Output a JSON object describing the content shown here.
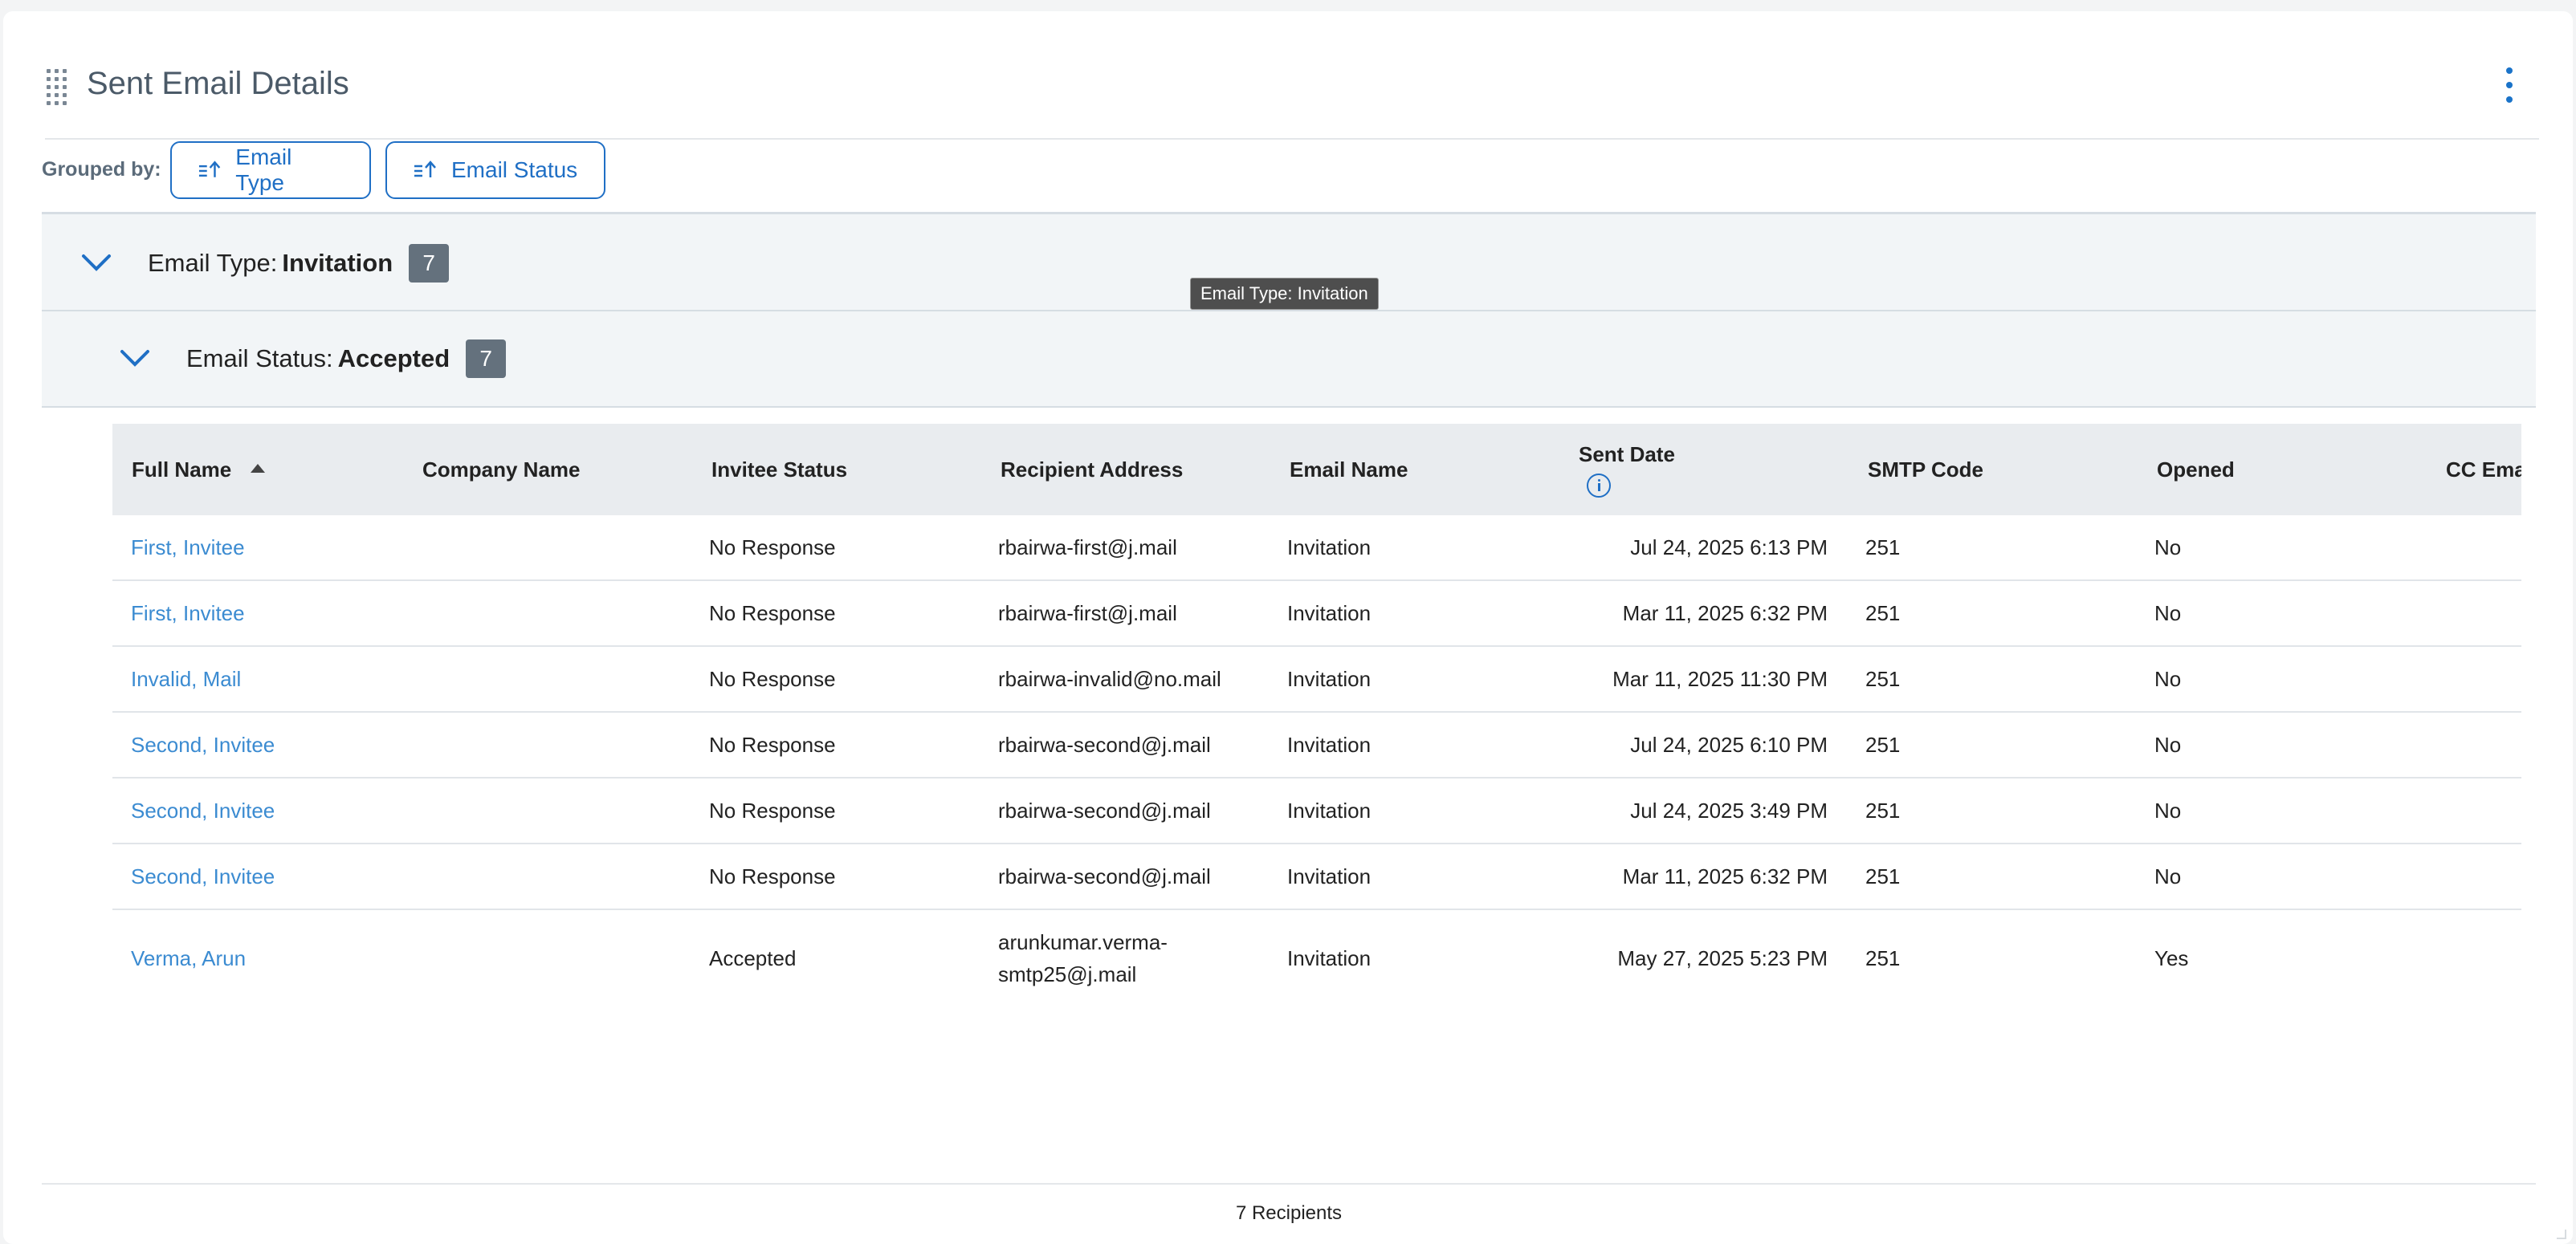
{
  "header": {
    "title": "Sent Email Details"
  },
  "toolbar": {
    "grouped_by_label": "Grouped by:",
    "chips": [
      {
        "label": "Email Type"
      },
      {
        "label": "Email Status"
      }
    ]
  },
  "groups": {
    "level1": {
      "prefix": "Email Type:",
      "value": "Invitation",
      "count": "7"
    },
    "level2": {
      "prefix": "Email Status:",
      "value": "Accepted",
      "count": "7"
    }
  },
  "tooltip": {
    "text": "Email Type: Invitation"
  },
  "table": {
    "columns": [
      "Full Name",
      "Company Name",
      "Invitee Status",
      "Recipient Address",
      "Email Name",
      "Sent Date",
      "SMTP Code",
      "Opened",
      "CC Ema"
    ],
    "rows": [
      {
        "full_name": "First, Invitee",
        "company": "",
        "status": "No Response",
        "address": "rbairwa-first@j.mail",
        "email_name": "Invitation",
        "sent": "Jul 24, 2025 6:13 PM",
        "smtp": "251",
        "opened": "No"
      },
      {
        "full_name": "First, Invitee",
        "company": "",
        "status": "No Response",
        "address": "rbairwa-first@j.mail",
        "email_name": "Invitation",
        "sent": "Mar 11, 2025 6:32 PM",
        "smtp": "251",
        "opened": "No"
      },
      {
        "full_name": "Invalid, Mail",
        "company": "",
        "status": "No Response",
        "address": "rbairwa-invalid@no.mail",
        "email_name": "Invitation",
        "sent": "Mar 11, 2025 11:30 PM",
        "smtp": "251",
        "opened": "No"
      },
      {
        "full_name": "Second, Invitee",
        "company": "",
        "status": "No Response",
        "address": "rbairwa-second@j.mail",
        "email_name": "Invitation",
        "sent": "Jul 24, 2025 6:10 PM",
        "smtp": "251",
        "opened": "No"
      },
      {
        "full_name": "Second, Invitee",
        "company": "",
        "status": "No Response",
        "address": "rbairwa-second@j.mail",
        "email_name": "Invitation",
        "sent": "Jul 24, 2025 3:49 PM",
        "smtp": "251",
        "opened": "No"
      },
      {
        "full_name": "Second, Invitee",
        "company": "",
        "status": "No Response",
        "address": "rbairwa-second@j.mail",
        "email_name": "Invitation",
        "sent": "Mar 11, 2025 6:32 PM",
        "smtp": "251",
        "opened": "No"
      },
      {
        "full_name": "Verma, Arun",
        "company": "",
        "status": "Accepted",
        "address_line1": "arunkumar.verma-",
        "address_line2": "smtp25@j.mail",
        "email_name": "Invitation",
        "sent": "May 27, 2025 5:23 PM",
        "smtp": "251",
        "opened": "Yes"
      }
    ]
  },
  "footer": {
    "summary": "7 Recipients"
  },
  "colors": {
    "accent": "#1f6fc5",
    "link": "#3b8bd1",
    "badge": "#64717d",
    "group_bg": "#f2f5f7"
  }
}
